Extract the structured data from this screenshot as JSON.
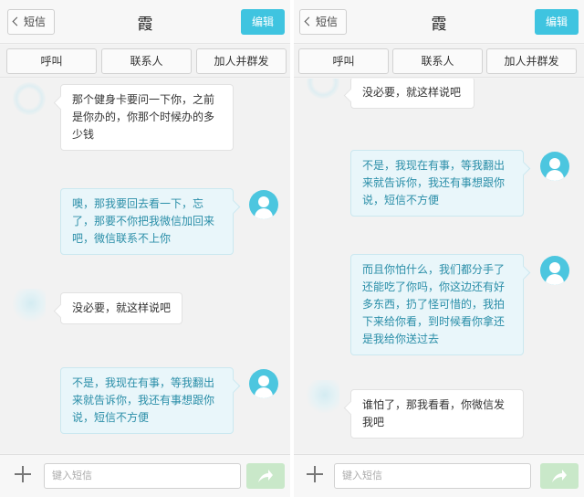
{
  "header": {
    "back_label": "短信",
    "title": "霞",
    "edit_label": "编辑"
  },
  "actions": [
    "呼叫",
    "联系人",
    "加人并群发"
  ],
  "composer": {
    "placeholder": "键入短信"
  },
  "left_messages": [
    {
      "from": "contact",
      "text": "那个健身卡要问一下你，之前是你办的，你那个时候办的多少钱"
    },
    {
      "from": "me",
      "text": "噢，那我要回去看一下，忘了，那要不你把我微信加回来吧，微信联系不上你"
    },
    {
      "from": "contact",
      "text": "没必要，就这样说吧"
    },
    {
      "from": "me",
      "text": "不是，我现在有事，等我翻出来就告诉你，我还有事想跟你说，短信不方便"
    }
  ],
  "right_messages": [
    {
      "from": "contact",
      "text": "没必要，就这样说吧"
    },
    {
      "from": "me",
      "text": "不是，我现在有事，等我翻出来就告诉你，我还有事想跟你说，短信不方便"
    },
    {
      "from": "me",
      "text": "而且你怕什么，我们都分手了还能吃了你吗，你这边还有好多东西，扔了怪可惜的，我拍下来给你看，到时候看你拿还是我给你送过去"
    },
    {
      "from": "contact",
      "text": "谁怕了，那我看看，你微信发我吧"
    }
  ],
  "colors": {
    "accent": "#3fc4e0",
    "outgoing_bubble": "#e9f6fa",
    "outgoing_text": "#2a8ea8",
    "send_button": "#c9e8c9"
  },
  "icons": {
    "back": "chevron-left-icon",
    "add": "plus-icon",
    "send": "send-arrow-icon",
    "my_avatar": "person-avatar-icon"
  }
}
